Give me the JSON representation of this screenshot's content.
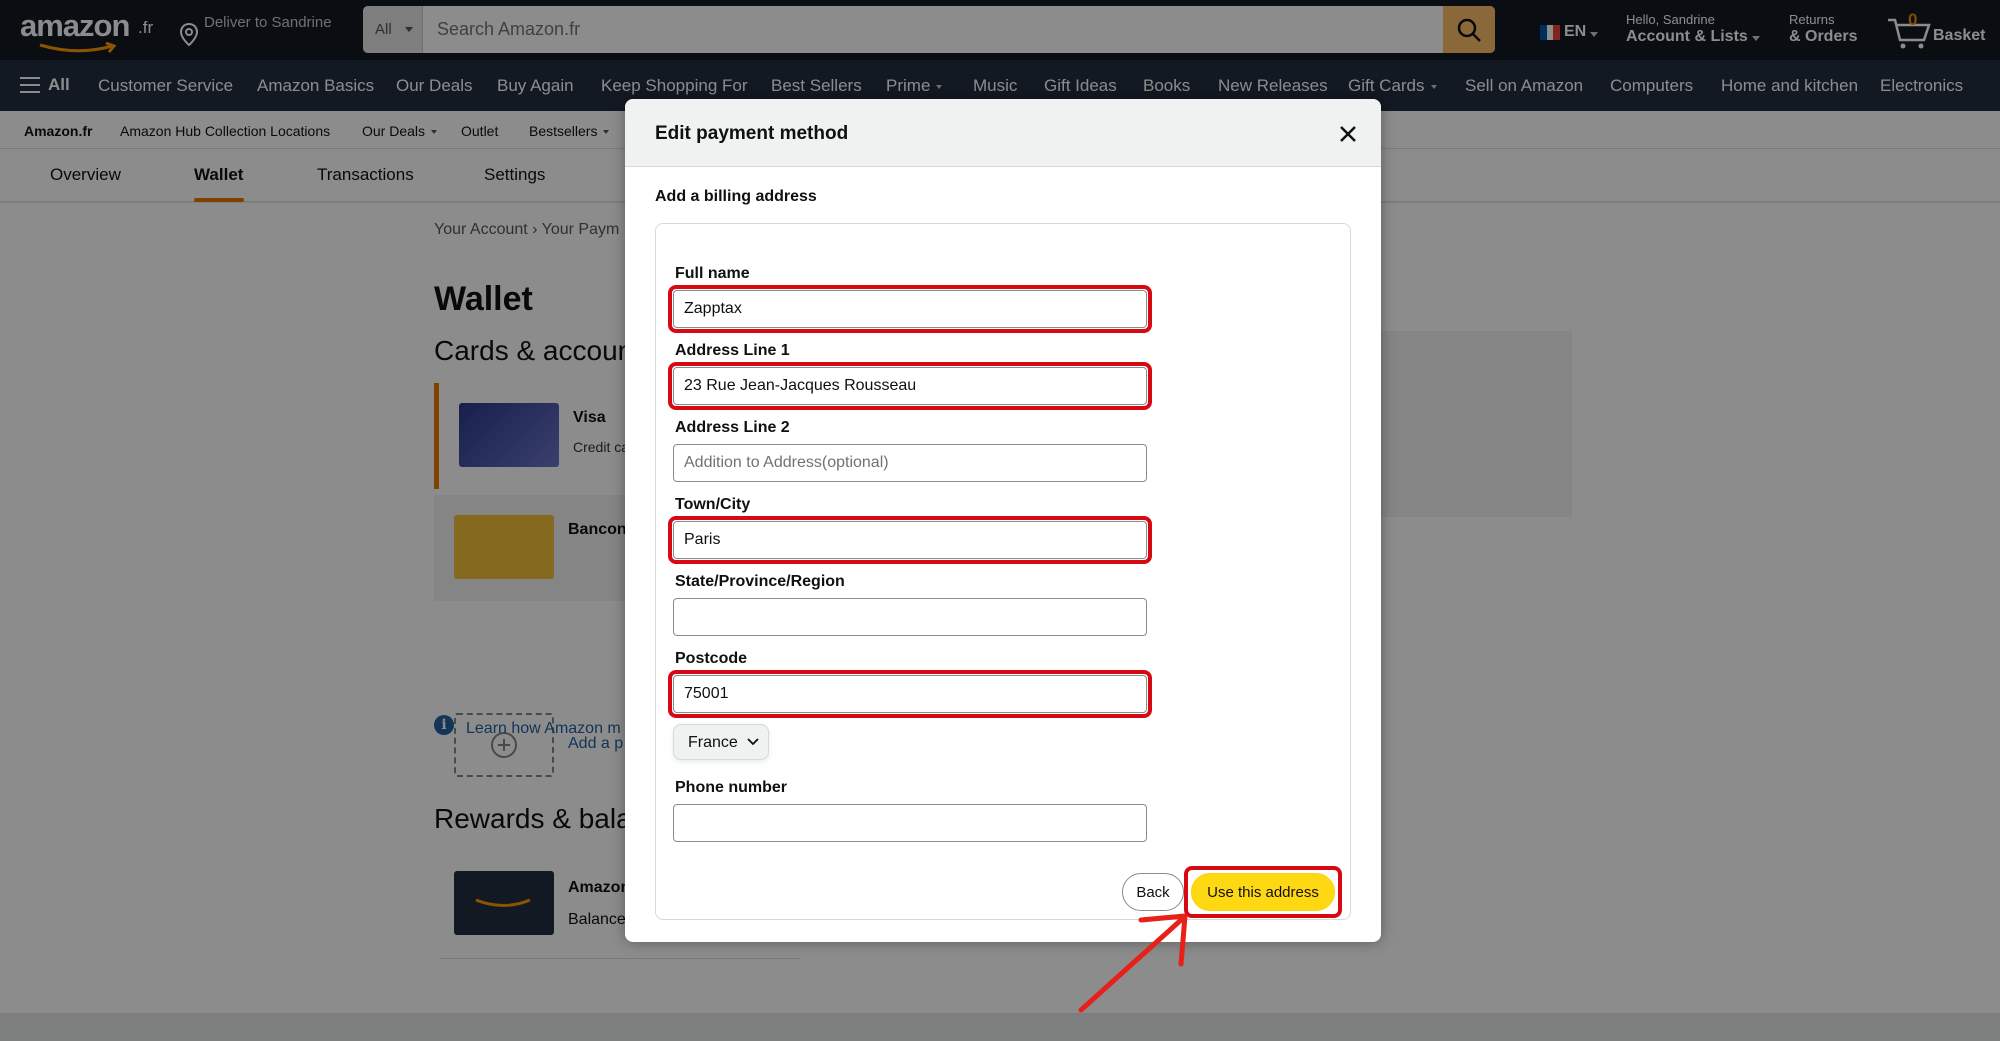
{
  "header": {
    "logo": "amazon",
    "logo_suffix": ".fr",
    "deliver_to": "Deliver to Sandrine",
    "search_category": "All",
    "search_placeholder": "Search Amazon.fr",
    "language": "EN",
    "account_greeting": "Hello, Sandrine",
    "account_label": "Account & Lists",
    "returns_small": "Returns",
    "returns_label": "& Orders",
    "basket_count": "0",
    "basket_label": "Basket"
  },
  "nav": {
    "all": "All",
    "items": [
      "Customer Service",
      "Amazon Basics",
      "Our Deals",
      "Buy Again",
      "Keep Shopping For",
      "Best Sellers",
      "Prime",
      "Music",
      "Gift Ideas",
      "Books",
      "New Releases",
      "Gift Cards",
      "Sell on Amazon",
      "Computers",
      "Home and kitchen",
      "Electronics"
    ]
  },
  "subnav": {
    "items": [
      "Amazon.fr",
      "Amazon Hub Collection Locations",
      "Our Deals",
      "Outlet",
      "Bestsellers"
    ]
  },
  "tabs": {
    "items": [
      "Overview",
      "Wallet",
      "Transactions",
      "Settings"
    ],
    "active": "Wallet"
  },
  "page": {
    "breadcrumb": "Your Account › Your Paym",
    "title": "Wallet",
    "cards_title": "Cards & accoun",
    "cards": [
      {
        "name": "Visa",
        "sub": "Credit ca"
      },
      {
        "name": "Bancon",
        "sub": ""
      }
    ],
    "add_payment": "Add a p",
    "info_text": "Learn how Amazon m methods",
    "rewards_title": "Rewards & bala",
    "gift_name": "Amazon",
    "gift_sub": "Balance"
  },
  "modal": {
    "title": "Edit payment method",
    "section": "Add a billing address",
    "fields": {
      "full_name": {
        "label": "Full name",
        "value": "Zapptax"
      },
      "address1": {
        "label": "Address Line 1",
        "value": "23 Rue Jean-Jacques Rousseau"
      },
      "address2": {
        "label": "Address Line 2",
        "placeholder": "Addition to Address(optional)",
        "value": ""
      },
      "city": {
        "label": "Town/City",
        "value": "Paris"
      },
      "state": {
        "label": "State/Province/Region",
        "value": ""
      },
      "postcode": {
        "label": "Postcode",
        "value": "75001"
      },
      "country": {
        "value": "France"
      },
      "phone": {
        "label": "Phone number",
        "value": ""
      }
    },
    "back_label": "Back",
    "use_label": "Use this address"
  },
  "colors": {
    "highlight": "#d70a14",
    "primary_button": "#ffd814",
    "header_bg": "#131921",
    "nav_bg": "#232f3e",
    "accent": "#e77600"
  }
}
